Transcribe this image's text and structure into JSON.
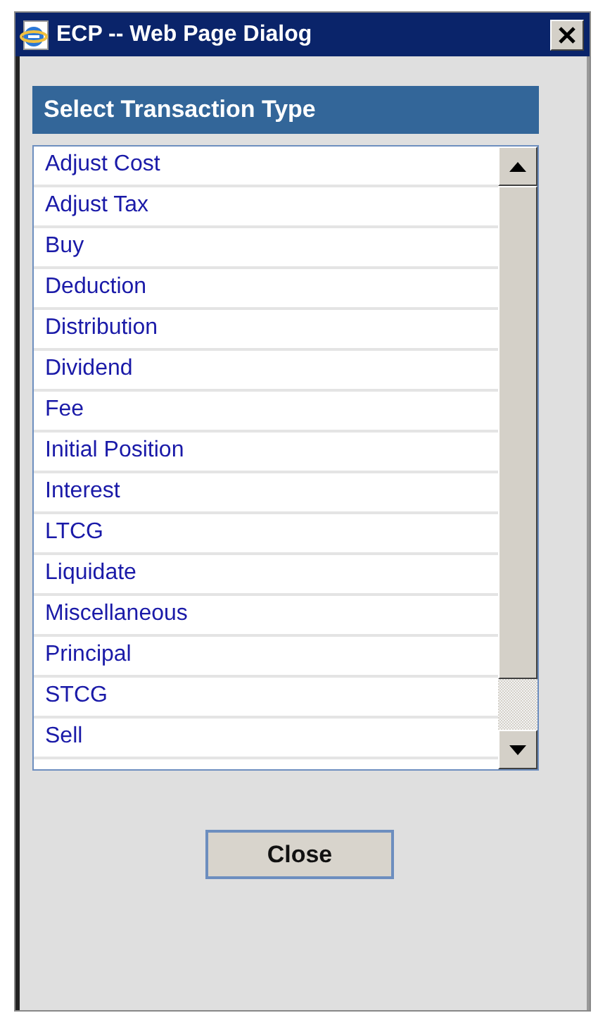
{
  "window": {
    "title": "ECP -- Web Page Dialog"
  },
  "panel": {
    "title": "Select Transaction Type"
  },
  "list": {
    "items": [
      {
        "label": "Adjust Cost"
      },
      {
        "label": "Adjust Tax"
      },
      {
        "label": "Buy"
      },
      {
        "label": "Deduction"
      },
      {
        "label": "Distribution"
      },
      {
        "label": "Dividend"
      },
      {
        "label": "Fee"
      },
      {
        "label": "Initial Position"
      },
      {
        "label": "Interest"
      },
      {
        "label": "LTCG"
      },
      {
        "label": "Liquidate"
      },
      {
        "label": "Miscellaneous"
      },
      {
        "label": "Principal"
      },
      {
        "label": "STCG"
      },
      {
        "label": "Sell"
      }
    ]
  },
  "buttons": [
    {
      "label": "Close"
    }
  ]
}
